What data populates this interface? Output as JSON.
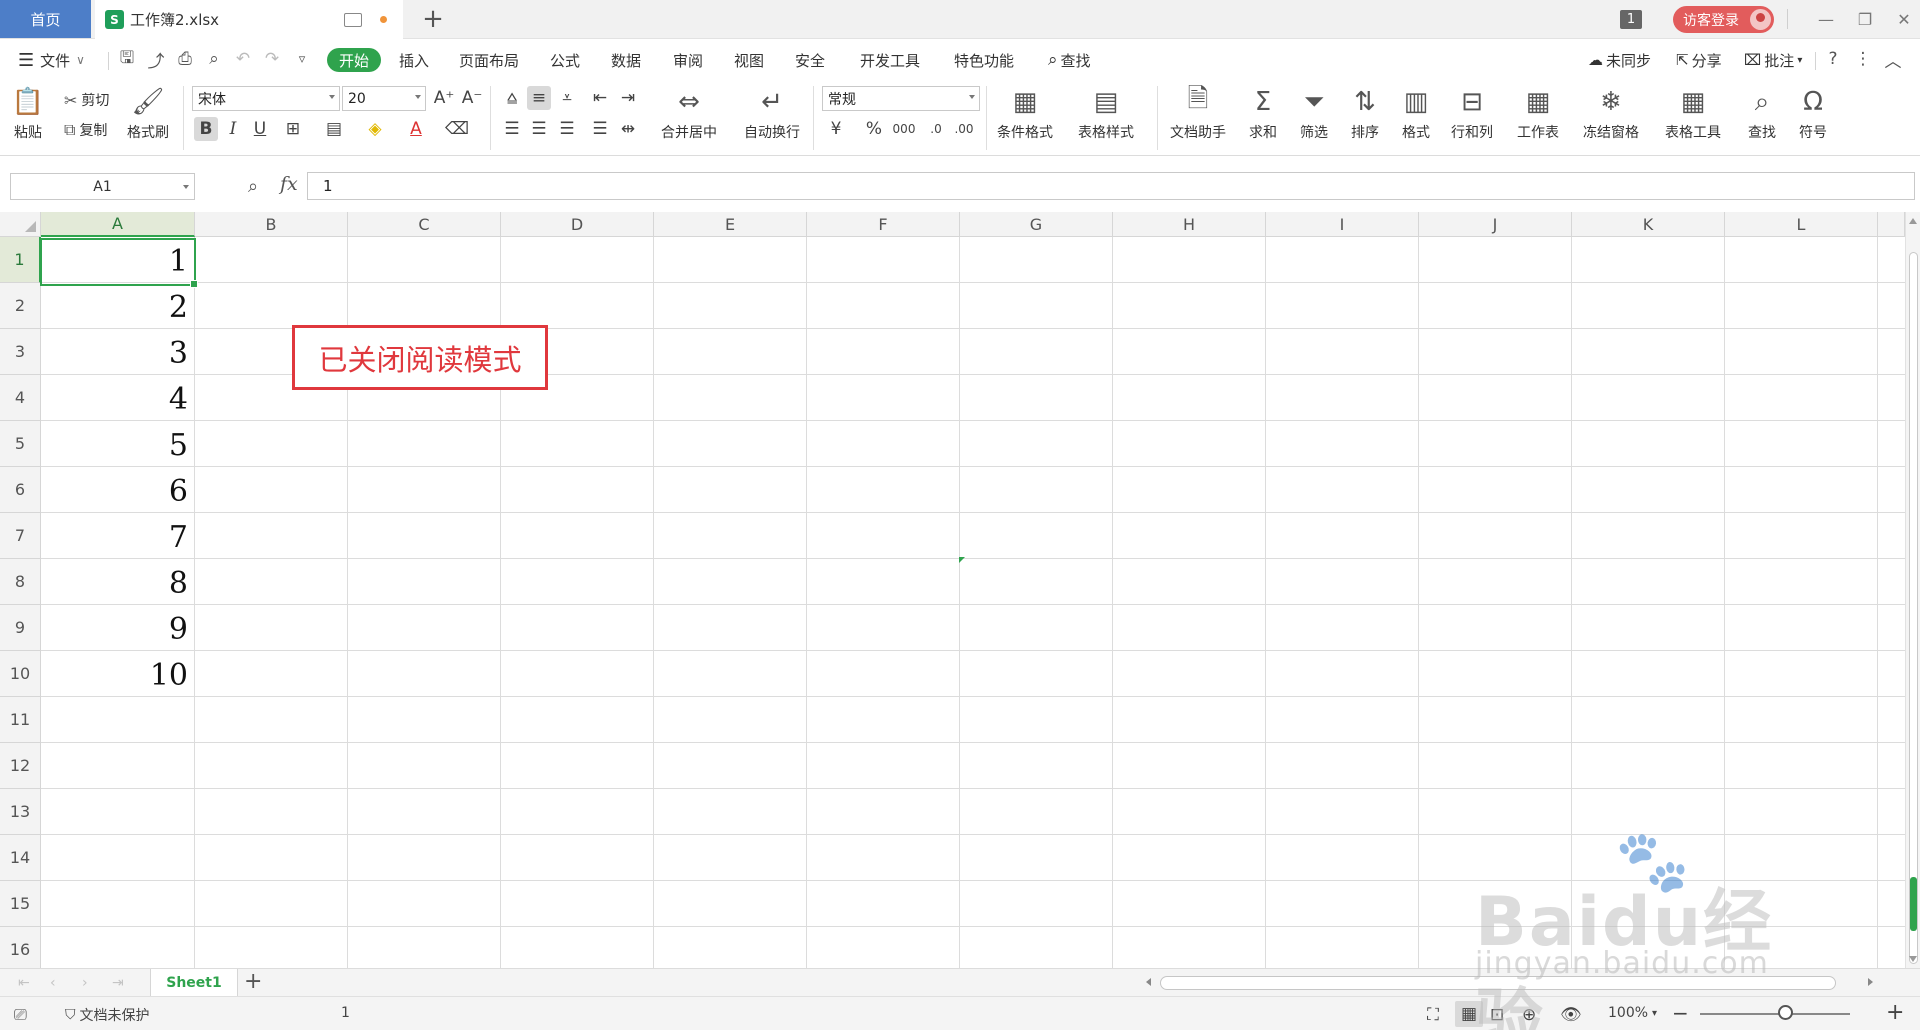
{
  "titlebar": {
    "home_tab": "首页",
    "doc_tab": "工作簿2.xlsx",
    "doc_icon": "S",
    "window_count": "1",
    "login_button": "访客登录"
  },
  "menu": {
    "file": "文件",
    "items": [
      "开始",
      "插入",
      "页面布局",
      "公式",
      "数据",
      "审阅",
      "视图",
      "安全",
      "开发工具",
      "特色功能"
    ],
    "active": "开始",
    "search": "查找",
    "sync": "未同步",
    "share": "分享",
    "comment": "批注"
  },
  "ribbon": {
    "paste": "粘贴",
    "cut": "剪切",
    "copy": "复制",
    "format_painter": "格式刷",
    "font_name": "宋体",
    "font_size": "20",
    "merge_center": "合并居中",
    "wrap_text": "自动换行",
    "number_format": "常规",
    "conditional_format": "条件格式",
    "table_style": "表格样式",
    "doc_helper": "文档助手",
    "sum": "求和",
    "filter": "筛选",
    "sort": "排序",
    "format": "格式",
    "row_col": "行和列",
    "worksheet": "工作表",
    "freeze": "冻结窗格",
    "table_tools": "表格工具",
    "find": "查找",
    "symbol": "符号"
  },
  "formula_bar": {
    "cell_ref": "A1",
    "fx": "fx",
    "value": "1"
  },
  "sheet": {
    "columns": [
      "A",
      "B",
      "C",
      "D",
      "E",
      "F",
      "G",
      "H",
      "I",
      "J",
      "K",
      "L"
    ],
    "rows": [
      "1",
      "2",
      "3",
      "4",
      "5",
      "6",
      "7",
      "8",
      "9",
      "10",
      "11",
      "12",
      "13",
      "14",
      "15",
      "16"
    ],
    "col_a_values": [
      "1",
      "2",
      "3",
      "4",
      "5",
      "6",
      "7",
      "8",
      "9",
      "10"
    ],
    "selected_cell": "A1",
    "annotation": "已关闭阅读模式"
  },
  "tabs": {
    "sheet_name": "Sheet1"
  },
  "statusbar": {
    "protection": "文档未保护",
    "cell_value": "1",
    "zoom": "100%"
  },
  "watermark": {
    "logo": "Baidu经验",
    "url": "jingyan.baidu.com"
  },
  "colors": {
    "accent_green": "#2fa34d",
    "home_tab_blue": "#4d7ec8",
    "annotation_red": "#e0383d",
    "login_red": "#e25c5c"
  }
}
